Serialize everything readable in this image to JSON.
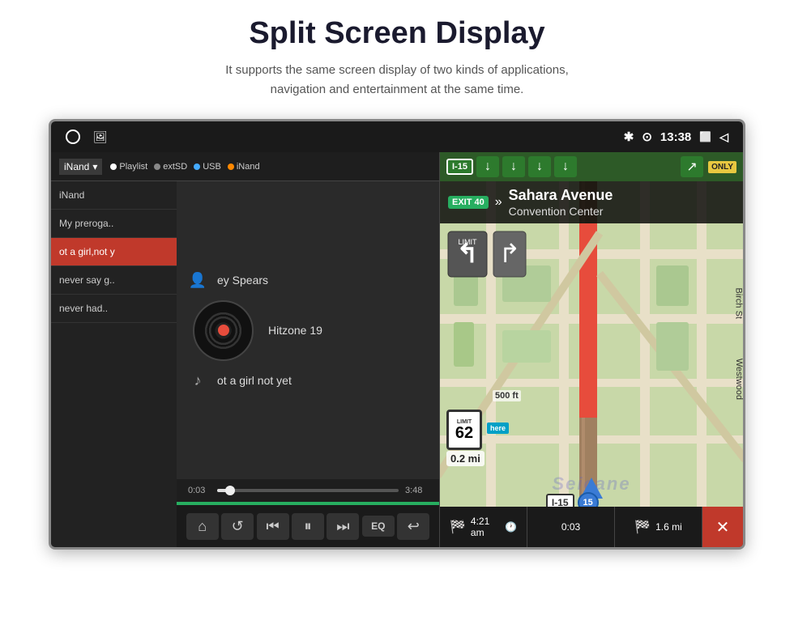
{
  "header": {
    "title": "Split Screen Display",
    "subtitle_line1": "It supports the same screen display of two kinds of applications,",
    "subtitle_line2": "navigation and entertainment at the same time."
  },
  "status_bar": {
    "time": "13:38",
    "icons": [
      "bluetooth",
      "location",
      "window",
      "back"
    ]
  },
  "music_player": {
    "source_dropdown": "iNand",
    "sources": [
      "Playlist",
      "extSD",
      "USB",
      "iNand"
    ],
    "playlist": [
      {
        "label": "iNand",
        "active": false
      },
      {
        "label": "My preroga..",
        "active": false
      },
      {
        "label": "ot a girl,not y",
        "active": true
      },
      {
        "label": "never say g..",
        "active": false
      },
      {
        "label": "never had..",
        "active": false
      }
    ],
    "track": {
      "artist": "ey Spears",
      "album": "Hitzone 19",
      "song": "ot a girl not yet"
    },
    "time_current": "0:03",
    "time_total": "3:48",
    "controls": [
      "home",
      "repeat",
      "prev",
      "play-pause",
      "next",
      "eq",
      "back"
    ]
  },
  "navigation": {
    "exit_number": "EXIT 40",
    "street_name": "Sahara Avenue",
    "place": "Convention Center",
    "speed_limit": "62",
    "distance_to_turn": "0.2 mi",
    "highway_label": "I-15",
    "highway_number": "15",
    "arrival_time": "4:21 am",
    "elapsed_time": "0:03",
    "remaining_distance": "1.6 mi"
  },
  "controls": {
    "home_label": "⌂",
    "repeat_label": "↺",
    "prev_label": "⏮",
    "pause_label": "⏸",
    "next_label": "⏭",
    "eq_label": "EQ",
    "back_label": "↩",
    "close_label": "✕"
  }
}
